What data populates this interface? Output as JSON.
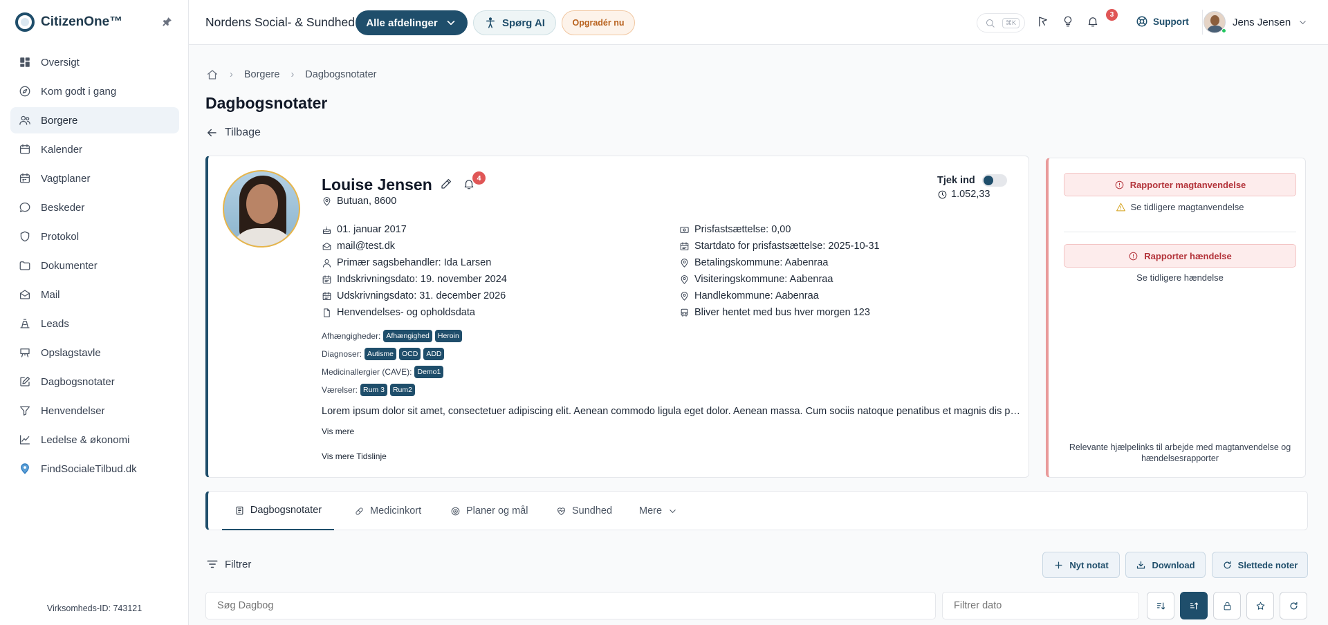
{
  "app": {
    "name": "CitizenOne™",
    "org": "Nordens Social- & Sundhed"
  },
  "sidebar": {
    "items": [
      {
        "label": "Oversigt"
      },
      {
        "label": "Kom godt i gang"
      },
      {
        "label": "Borgere"
      },
      {
        "label": "Kalender"
      },
      {
        "label": "Vagtplaner"
      },
      {
        "label": "Beskeder"
      },
      {
        "label": "Protokol"
      },
      {
        "label": "Dokumenter"
      },
      {
        "label": "Mail"
      },
      {
        "label": "Leads"
      },
      {
        "label": "Opslagstavle"
      },
      {
        "label": "Dagbogsnotater"
      },
      {
        "label": "Henvendelser"
      },
      {
        "label": "Ledelse & økonomi"
      },
      {
        "label": "FindSocialeTilbud.dk"
      }
    ],
    "active_item": "Borgere",
    "company_id": "Virksomheds-ID: 743121"
  },
  "header": {
    "department_button": "Alle afdelinger",
    "ai_button": "Spørg AI",
    "upgrade_button": "Opgradér nu",
    "search_shortcut": "⌘K",
    "notifications_count": "3",
    "support_label": "Support",
    "user_name": "Jens Jensen"
  },
  "breadcrumb": {
    "items": [
      "Borgere",
      "Dagbogsnotater"
    ]
  },
  "page": {
    "title": "Dagbogsnotater",
    "back_label": "Tilbage"
  },
  "profile": {
    "name": "Louise Jensen",
    "alerts_count": "4",
    "location": "Butuan, 8600",
    "left_details": [
      "01. januar 2017",
      "mail@test.dk",
      "Primær sagsbehandler: Ida Larsen",
      "Indskrivningsdato: 19. november 2024",
      "Udskrivningsdato: 31. december 2026",
      "Henvendelses- og opholdsdata"
    ],
    "right_details": [
      "Prisfastsættelse: 0,00",
      "Startdato for prisfastsættelse: 2025-10-31",
      "Betalingskommune: Aabenraa",
      "Visiteringskommune: Aabenraa",
      "Handlekommune: Aabenraa",
      "Bliver hentet med bus hver morgen 123"
    ],
    "tag_groups": [
      {
        "label": "Afhængigheder:",
        "tags": [
          "Afhængighed",
          "Heroin"
        ]
      },
      {
        "label": "Diagnoser:",
        "tags": [
          "Autisme",
          "OCD",
          "ADD"
        ]
      },
      {
        "label": "Medicinallergier (CAVE):",
        "tags": [
          "Demo1"
        ]
      },
      {
        "label": "Værelser:",
        "tags": [
          "Rum 3",
          "Rum2"
        ]
      }
    ],
    "description": "Lorem ipsum dolor sit amet, consectetuer adipiscing elit. Aenean commodo ligula eget dolor. Aenean massa. Cum sociis natoque penatibus et magnis dis parturient montes, nascetur ridiculus mus.",
    "show_more": "Vis mere",
    "show_timeline": "Vis mere Tidslinje",
    "checkin_label": "Tjek ind",
    "balance": "1.052,33"
  },
  "reports": {
    "report_force": "Rapporter magtanvendelse",
    "previous_force": "Se tidligere magtanvendelse",
    "report_incident": "Rapporter hændelse",
    "previous_incident": "Se tidligere hændelse",
    "help_text": "Relevante hjælpelinks til arbejde med magtanvendelse og hændelsesrapporter"
  },
  "tabs": [
    {
      "label": "Dagbogsnotater"
    },
    {
      "label": "Medicinkort"
    },
    {
      "label": "Planer og mål"
    },
    {
      "label": "Sundhed"
    },
    {
      "label": "Mere"
    }
  ],
  "toolbar": {
    "filter_label": "Filtrer",
    "new_note": "Nyt notat",
    "download": "Download",
    "deleted_notes": "Slettede noter",
    "search_placeholder": "Søg Dagbog",
    "date_placeholder": "Filtrer dato"
  },
  "colors": {
    "primary": "#1f4e6b",
    "danger": "#b3333a",
    "accent_orange": "#b8621e"
  }
}
